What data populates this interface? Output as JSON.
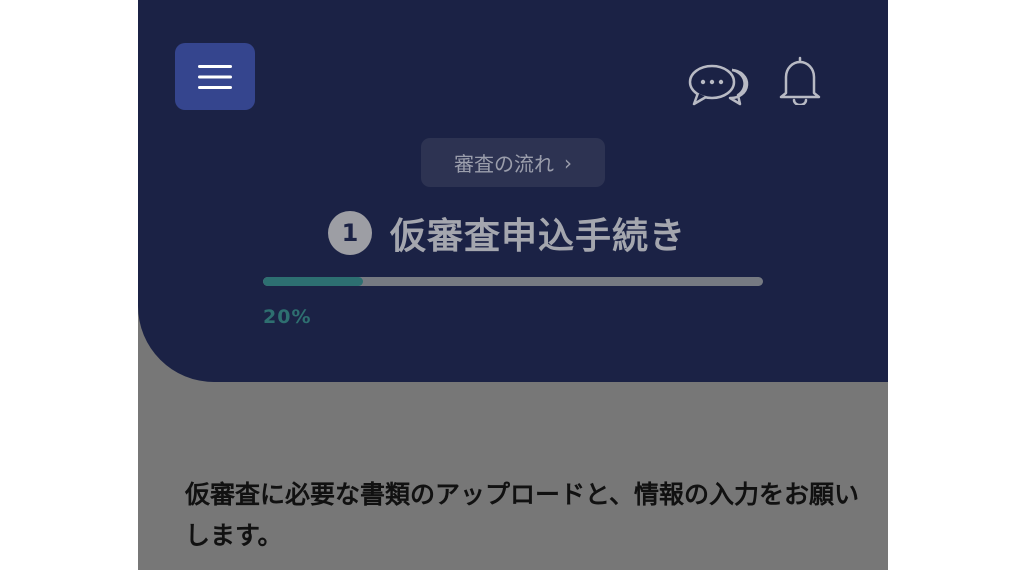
{
  "header": {
    "icons": {
      "menu": "menu-icon",
      "chat": "chat-icon",
      "notifications": "bell-icon"
    },
    "flow_chip": {
      "label": "審査の流れ",
      "chevron": "›"
    },
    "step": {
      "number": "1",
      "title": "仮審査申込手続き"
    },
    "progress": {
      "value": 0.2,
      "label": "20%"
    },
    "colors": {
      "header_bg": "#1b2245",
      "menu_button_bg": "#35458e",
      "progress_fill": "#2d6f71",
      "page_bg": "#777777"
    }
  },
  "body": {
    "instruction": "仮審査に必要な書類のアップロードと、情報の入力をお願いします。"
  }
}
